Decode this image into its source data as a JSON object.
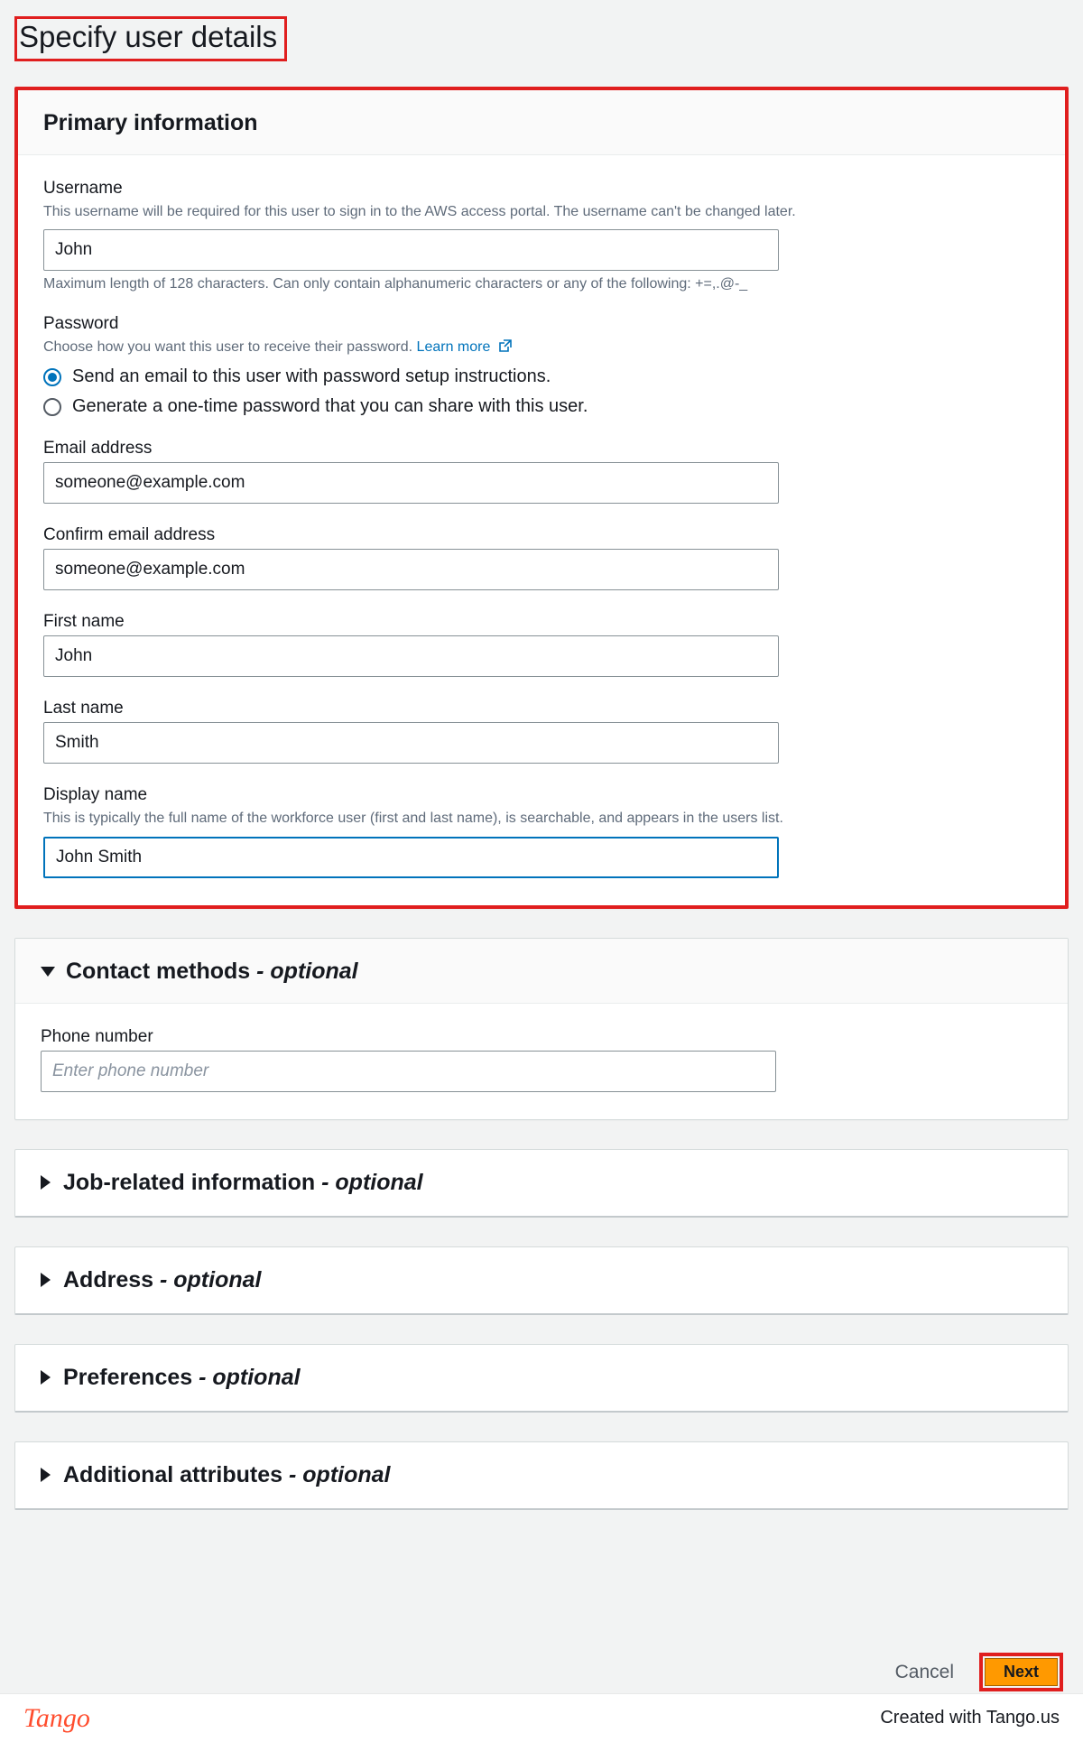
{
  "page_title": "Specify user details",
  "primary": {
    "heading": "Primary information",
    "username": {
      "label": "Username",
      "hint": "This username will be required for this user to sign in to the AWS access portal. The username can't be changed later.",
      "value": "John",
      "subhint": "Maximum length of 128 characters. Can only contain alphanumeric characters or any of the following: +=,.@-_"
    },
    "password": {
      "label": "Password",
      "hint_prefix": "Choose how you want this user to receive their password. ",
      "learn_more": "Learn more",
      "option_email": "Send an email to this user with password setup instructions.",
      "option_generate": "Generate a one-time password that you can share with this user."
    },
    "email": {
      "label": "Email address",
      "value": "someone@example.com"
    },
    "confirm_email": {
      "label": "Confirm email address",
      "value": "someone@example.com"
    },
    "first_name": {
      "label": "First name",
      "value": "John"
    },
    "last_name": {
      "label": "Last name",
      "value": "Smith"
    },
    "display_name": {
      "label": "Display name",
      "hint": "This is typically the full name of the workforce user (first and last name), is searchable, and appears in the users list.",
      "value": "John Smith"
    }
  },
  "contact": {
    "heading": "Contact methods",
    "optional": " - optional",
    "phone_label": "Phone number",
    "phone_placeholder": "Enter phone number"
  },
  "collapsed_sections": {
    "job": {
      "heading": "Job-related information",
      "optional": " - optional"
    },
    "address": {
      "heading": "Address",
      "optional": " - optional"
    },
    "preferences": {
      "heading": "Preferences",
      "optional": " - optional"
    },
    "additional": {
      "heading": "Additional attributes",
      "optional": " - optional"
    }
  },
  "actions": {
    "cancel": "Cancel",
    "next": "Next"
  },
  "footer": {
    "logo": "Tango",
    "credit": "Created with Tango.us"
  }
}
